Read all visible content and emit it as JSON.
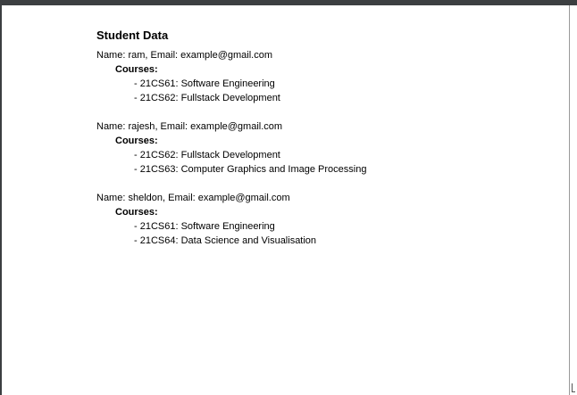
{
  "document": {
    "title": "Student Data",
    "name_prefix": "Name: ",
    "email_prefix": ", Email: ",
    "courses_heading": "Courses:"
  },
  "students": [
    {
      "name": "ram",
      "email": "example@gmail.com",
      "courses": [
        "21CS61: Software Engineering",
        "21CS62: Fullstack Development"
      ]
    },
    {
      "name": "rajesh",
      "email": "example@gmail.com",
      "courses": [
        "21CS62: Fullstack Development",
        "21CS63: Computer Graphics and Image Processing"
      ]
    },
    {
      "name": "sheldon",
      "email": "example@gmail.com",
      "courses": [
        "21CS61: Software Engineering",
        "21CS64: Data Science and Visualisation"
      ]
    }
  ]
}
